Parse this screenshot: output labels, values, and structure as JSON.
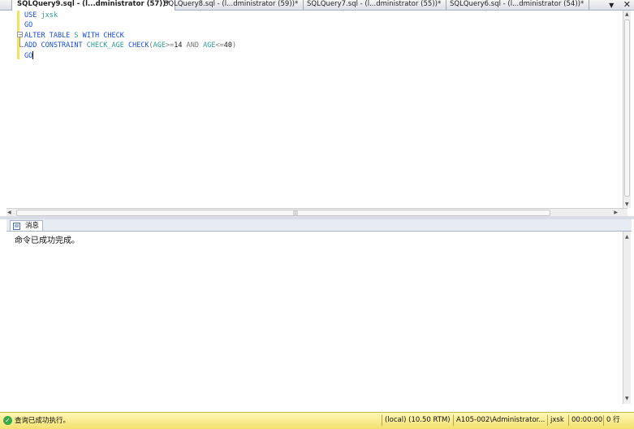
{
  "tabs": [
    {
      "label": "SQLQuery9.sql - (l...dministrator (57))*",
      "active": true
    },
    {
      "label": "SQLQuery8.sql - (l...dministrator (59))*",
      "active": false
    },
    {
      "label": "SQLQuery7.sql - (l...dministrator (55))*",
      "active": false
    },
    {
      "label": "SQLQuery6.sql - (l...dministrator (54))*",
      "active": false
    }
  ],
  "tab_tools": {
    "dropdown": "▼",
    "close": "✕"
  },
  "editor": {
    "lines": [
      [
        {
          "t": "USE ",
          "c": "kw"
        },
        {
          "t": "jxsk",
          "c": "id"
        }
      ],
      [
        {
          "t": "GO",
          "c": "kw"
        }
      ],
      [
        {
          "t": "ALTER TABLE ",
          "c": "kw"
        },
        {
          "t": "S ",
          "c": "id"
        },
        {
          "t": "WITH CHECK",
          "c": "kw"
        }
      ],
      [
        {
          "t": "ADD CONSTRAINT ",
          "c": "kw"
        },
        {
          "t": "CHECK_AGE ",
          "c": "id"
        },
        {
          "t": "CHECK",
          "c": "kw"
        },
        {
          "t": "(",
          "c": "op"
        },
        {
          "t": "AGE",
          "c": "id"
        },
        {
          "t": ">=",
          "c": "op"
        },
        {
          "t": "14 ",
          "c": "num"
        },
        {
          "t": "AND ",
          "c": "op"
        },
        {
          "t": "AGE",
          "c": "id"
        },
        {
          "t": "<=",
          "c": "op"
        },
        {
          "t": "40",
          "c": "num"
        },
        {
          "t": ")",
          "c": "op"
        }
      ],
      [
        {
          "t": "GO",
          "c": "kw"
        }
      ]
    ]
  },
  "results": {
    "tab_label": "消息",
    "message": "命令已成功完成。"
  },
  "status": {
    "text": "查询已成功执行。",
    "server": "(local) (10.50 RTM)",
    "connection": "A105-002\\Administrator...",
    "database": "jxsk",
    "elapsed": "00:00:00",
    "rows": "0 行"
  },
  "colors": {
    "keyword": "#1a4fcf",
    "identifier": "#2a9d8f",
    "status_bg": "#f3e170"
  }
}
